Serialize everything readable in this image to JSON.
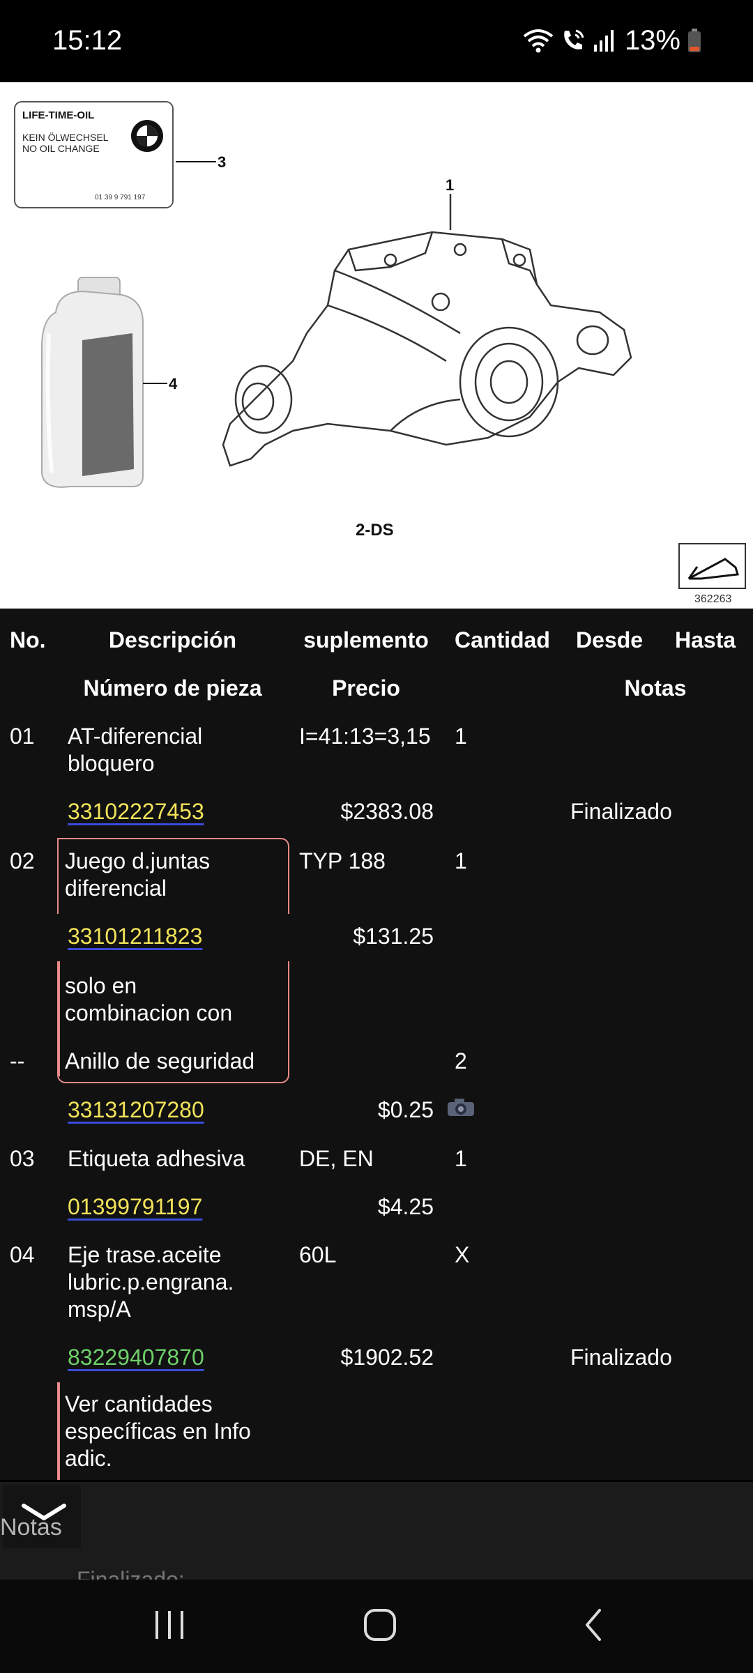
{
  "status_bar": {
    "time": "15:12",
    "battery": "13%",
    "icons": [
      "wifi-icon",
      "wifi-calling-icon",
      "signal-icon",
      "battery-icon"
    ],
    "battery_color": "#e0572e"
  },
  "diagram": {
    "label_title": "LIFE-TIME-OIL",
    "label_line1": "KEIN ÖLWECHSEL",
    "label_line2": "NO OIL CHANGE",
    "label_number": "01 39 9 791 197",
    "callouts": [
      "1",
      "3",
      "4"
    ],
    "model": "2-DS",
    "ref_number": "362263"
  },
  "table": {
    "headers": {
      "no": "No.",
      "description": "Descripción",
      "supplement": "suplemento",
      "quantity": "Cantidad",
      "from": "Desde",
      "to": "Hasta",
      "part_number": "Número de pieza",
      "price": "Precio",
      "notes": "Notas"
    },
    "items": [
      {
        "no": "01",
        "description": [
          "AT-diferencial",
          "bloquero"
        ],
        "supplement": "I=41:13=3,15",
        "quantity": "1",
        "part_number": "33102227453",
        "price": "$2383.08",
        "status": "Finalizado"
      },
      {
        "no": "02",
        "description": [
          "Juego d.juntas",
          "diferencial"
        ],
        "supplement": "TYP 188",
        "quantity": "1",
        "part_number": "33101211823",
        "price": "$131.25",
        "note": [
          "solo en",
          "combinacion con"
        ]
      },
      {
        "no": "--",
        "description": [
          "Anillo de seguridad"
        ],
        "quantity": "2",
        "part_number": "33131207280",
        "price": "$0.25"
      },
      {
        "no": "03",
        "description": [
          "Etiqueta adhesiva"
        ],
        "supplement": "DE, EN",
        "quantity": "1",
        "part_number": "01399791197",
        "price": "$4.25"
      },
      {
        "no": "04",
        "description": [
          "Eje trase.aceite",
          "lubric.p.engrana.",
          "msp/A"
        ],
        "supplement": "60L",
        "quantity": "X",
        "part_number": "83229407870",
        "price": "$1902.52",
        "status": "Finalizado",
        "note": [
          "Ver cantidades",
          "específicas en Info",
          "adic."
        ]
      }
    ]
  },
  "notes_panel": {
    "label": "Notas",
    "partial_text": "Finalizado: ... ... ... ..."
  },
  "colors": {
    "part_link_yellow": "#f2e35a",
    "part_link_green": "#6fd06a",
    "link_underline": "#3a4ad8",
    "note_accent": "#e98a88",
    "table_bg": "#111111"
  }
}
